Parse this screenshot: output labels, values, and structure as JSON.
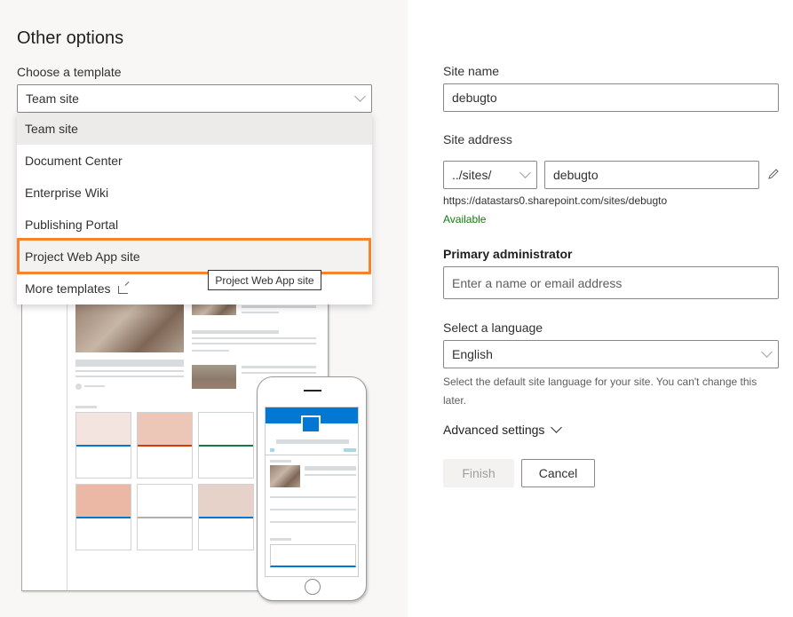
{
  "left": {
    "title": "Other options",
    "template_label": "Choose a template",
    "template_selected": "Team site",
    "dropdown_items": [
      {
        "label": "Team site",
        "state": "selected"
      },
      {
        "label": "Document Center",
        "state": "normal"
      },
      {
        "label": "Enterprise Wiki",
        "state": "normal"
      },
      {
        "label": "Publishing Portal",
        "state": "normal"
      },
      {
        "label": "Project Web App site",
        "state": "hover"
      }
    ],
    "more_templates": "More templates",
    "more_templates_icon": "external-link-icon",
    "tooltip": "Project Web App site",
    "highlight_color": "#f6822c"
  },
  "right": {
    "site_name_label": "Site name",
    "site_name_value": "debugto",
    "site_address_label": "Site address",
    "site_address_prefix": "../sites/",
    "site_address_value": "debugto",
    "edit_icon": "pencil-icon",
    "full_url": "https://datastars0.sharepoint.com/sites/debugto",
    "availability": "Available",
    "availability_color": "#107c10",
    "admin_label": "Primary administrator",
    "admin_placeholder": "Enter a name or email address",
    "language_label": "Select a language",
    "language_value": "English",
    "language_help": "Select the default site language for your site. You can't change this later.",
    "advanced_settings": "Advanced settings",
    "finish_label": "Finish",
    "cancel_label": "Cancel"
  }
}
